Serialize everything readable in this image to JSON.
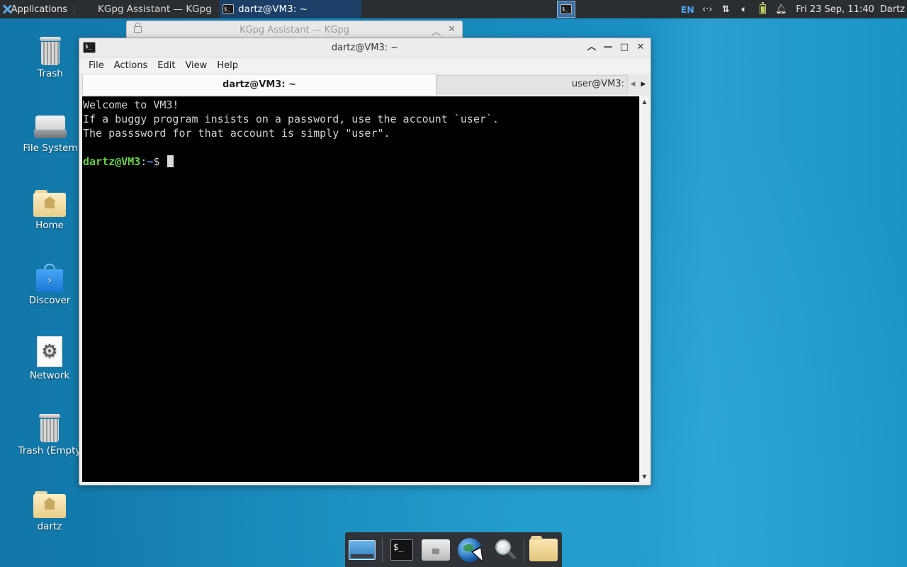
{
  "top_panel": {
    "applications_label": "Applications",
    "tasks": [
      {
        "label": "KGpg Assistant — KGpg",
        "active": false
      },
      {
        "label": "dartz@VM3: ~",
        "active": true
      }
    ],
    "language": "EN",
    "clock": "Fri 23 Sep, 11:40",
    "user": "Dartz",
    "tray_icons": [
      "network-arrows-icon",
      "network-updown-icon",
      "volume-icon",
      "battery-icon",
      "notification-bell-icon"
    ]
  },
  "desktop_icons": [
    {
      "label": "Trash",
      "icon": "trash-icon"
    },
    {
      "label": "File System",
      "icon": "drive-icon"
    },
    {
      "label": "Home",
      "icon": "home-folder-icon"
    },
    {
      "label": "Discover",
      "icon": "discover-bag-icon"
    },
    {
      "label": "Network",
      "icon": "network-gear-icon"
    },
    {
      "label": "Trash (Empty",
      "icon": "trash-icon"
    },
    {
      "label": "dartz",
      "icon": "home-folder-icon"
    }
  ],
  "background_window": {
    "title": "KGpg Assistant — KGpg"
  },
  "terminal_window": {
    "title": "dartz@VM3: ~",
    "menu": [
      "File",
      "Actions",
      "Edit",
      "View",
      "Help"
    ],
    "tabs": [
      {
        "label": "dartz@VM3: ~",
        "active": true
      },
      {
        "label": "user@VM3:",
        "active": false
      }
    ],
    "output_lines": [
      "Welcome to VM3!",
      "If a buggy program insists on a password, use the account `user`.",
      "The passsword for that account is simply \"user\".",
      ""
    ],
    "prompt": {
      "user_host": "dartz@VM3",
      "separator": ":",
      "path": "~",
      "symbol": "$ "
    }
  },
  "dock": {
    "items": [
      "show-desktop-icon",
      "terminal-icon",
      "file-manager-icon",
      "web-browser-icon",
      "app-finder-icon",
      "open-folder-icon"
    ]
  },
  "colors": {
    "terminal_bg": "#000000",
    "prompt_user": "#6bd24a",
    "prompt_path": "#5c8cf0",
    "active_task": "#1b3f66"
  }
}
